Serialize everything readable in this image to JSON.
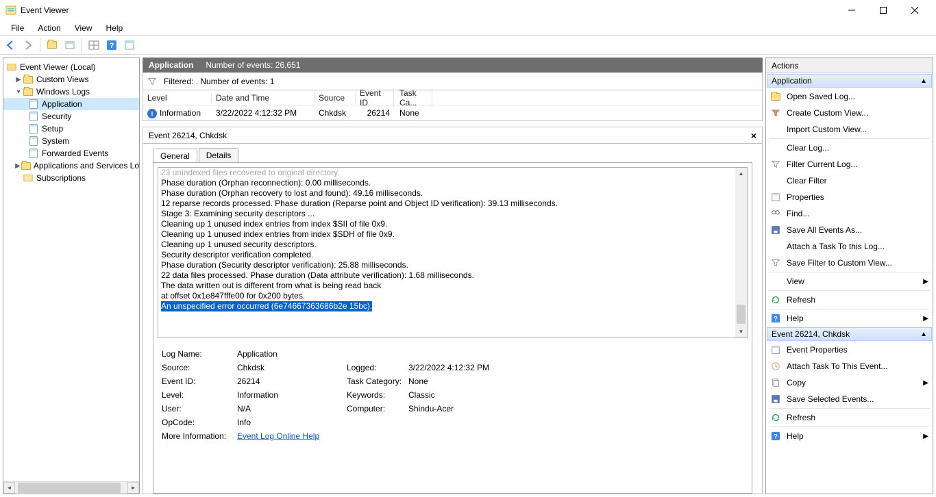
{
  "window": {
    "title": "Event Viewer"
  },
  "menu": {
    "file": "File",
    "action": "Action",
    "view": "View",
    "help": "Help"
  },
  "tree": {
    "root": "Event Viewer (Local)",
    "customViews": "Custom Views",
    "winLogs": "Windows Logs",
    "leafs": {
      "application": "Application",
      "security": "Security",
      "setup": "Setup",
      "system": "System",
      "forwarded": "Forwarded Events"
    },
    "appsAndServices": "Applications and Services Lo",
    "subscriptions": "Subscriptions"
  },
  "center": {
    "header_name": "Application",
    "header_count": "Number of events: 26,651",
    "filter_text": "Filtered: . Number of events: 1",
    "columns": {
      "level": "Level",
      "dt": "Date and Time",
      "src": "Source",
      "eid": "Event ID",
      "tc": "Task Ca..."
    },
    "row": {
      "level": "Information",
      "dt": "3/22/2022 4:12:32 PM",
      "src": "Chkdsk",
      "eid": "26214",
      "tc": "None"
    }
  },
  "detail": {
    "title": "Event 26214, Chkdsk",
    "tabs": {
      "general": "General",
      "details": "Details"
    },
    "log_lines": [
      "23 unindexed files recovered to original directory.",
      "Phase duration (Orphan reconnection): 0.00 milliseconds.",
      "",
      "Phase duration (Orphan recovery to lost and found): 49.16 milliseconds.",
      "  12 reparse records processed.                                         Phase duration (Reparse point and Object ID verification): 39.13 milliseconds.",
      "",
      "Stage 3: Examining security descriptors ...",
      "Cleaning up 1 unused index entries from index $SII of file 0x9.",
      "Cleaning up 1 unused index entries from index $SDH of file 0x9.",
      "Cleaning up 1 unused security descriptors.",
      "Security descriptor verification completed.",
      " Phase duration (Security descriptor verification): 25.88 milliseconds.",
      "  22 data files processed.                                           Phase duration (Data attribute verification): 1.68 milliseconds.",
      "The data written out is different from what is being read back",
      "at offset 0x1e847fffe00 for 0x200 bytes."
    ],
    "log_highlight": "An unspecified error occurred (6e74667363686b2e 15bc).",
    "props": {
      "log_name_lbl": "Log Name:",
      "log_name": "Application",
      "source_lbl": "Source:",
      "source": "Chkdsk",
      "logged_lbl": "Logged:",
      "logged": "3/22/2022 4:12:32 PM",
      "eid_lbl": "Event ID:",
      "eid": "26214",
      "taskcat_lbl": "Task Category:",
      "taskcat": "None",
      "level_lbl": "Level:",
      "level": "Information",
      "keywords_lbl": "Keywords:",
      "keywords": "Classic",
      "user_lbl": "User:",
      "user": "N/A",
      "computer_lbl": "Computer:",
      "computer": "Shindu-Acer",
      "opcode_lbl": "OpCode:",
      "opcode": "Info",
      "moreinfo_lbl": "More Information:",
      "moreinfo_link": "Event Log Online Help"
    }
  },
  "actions": {
    "title": "Actions",
    "sec1": "Application",
    "items1": [
      "Open Saved Log...",
      "Create Custom View...",
      "Import Custom View...",
      "Clear Log...",
      "Filter Current Log...",
      "Clear Filter",
      "Properties",
      "Find...",
      "Save All Events As...",
      "Attach a Task To this Log...",
      "Save Filter to Custom View...",
      "View",
      "Refresh",
      "Help"
    ],
    "sec2": "Event 26214, Chkdsk",
    "items2": [
      "Event Properties",
      "Attach Task To This Event...",
      "Copy",
      "Save Selected Events...",
      "Refresh",
      "Help"
    ]
  }
}
